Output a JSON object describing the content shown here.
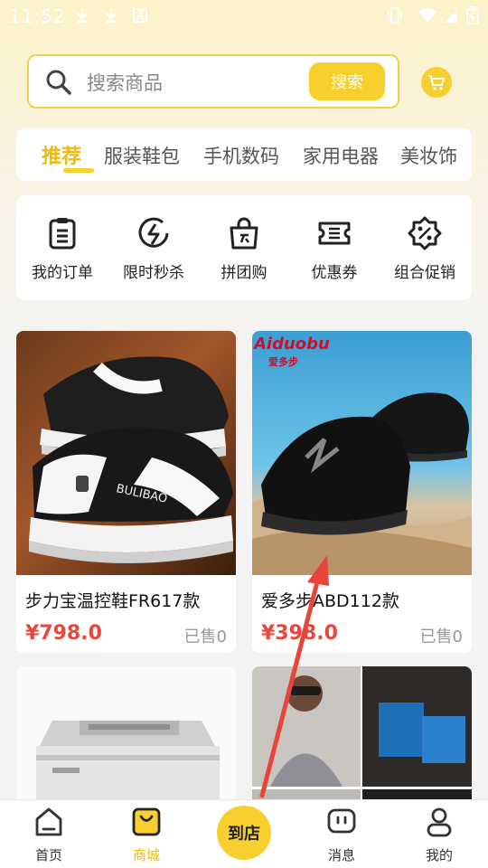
{
  "status_bar": {
    "time": "11:52"
  },
  "search": {
    "placeholder": "搜索商品",
    "button_label": "搜索"
  },
  "tabs": [
    {
      "label": "推荐",
      "active": true
    },
    {
      "label": "服装鞋包"
    },
    {
      "label": "手机数码"
    },
    {
      "label": "家用电器"
    },
    {
      "label": "美妆饰"
    }
  ],
  "quick_menu": [
    {
      "label": "我的订单",
      "icon": "clipboard-icon"
    },
    {
      "label": "限时秒杀",
      "icon": "lightning-icon"
    },
    {
      "label": "拼团购",
      "icon": "shopping-bag-icon"
    },
    {
      "label": "优惠券",
      "icon": "ticket-icon"
    },
    {
      "label": "组合促销",
      "icon": "discount-badge-icon"
    }
  ],
  "products": [
    {
      "name": "步力宝温控鞋FR617款",
      "price": "¥798.0",
      "sold": "已售0",
      "image_text": "BULIBAO"
    },
    {
      "name": "爱多步ABD112款",
      "price": "¥398.0",
      "sold": "已售0",
      "brand_text": "Aiduobu",
      "brand_sub": "爱多步"
    }
  ],
  "bottom_nav": [
    {
      "label": "首页",
      "icon": "home-icon"
    },
    {
      "label": "商城",
      "icon": "shopping-bag-icon",
      "active": true
    },
    {
      "label": "消息",
      "icon": "message-icon"
    },
    {
      "label": "我的",
      "icon": "user-icon"
    }
  ],
  "store_button": {
    "label": "到店"
  },
  "colors": {
    "accent": "#f7cf2f",
    "price": "#e9473a",
    "annotation_arrow": "#e8443a"
  }
}
